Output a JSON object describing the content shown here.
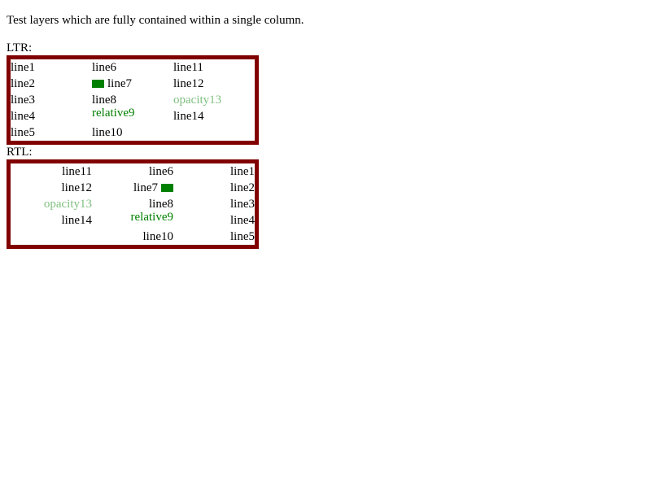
{
  "intro": "Test layers which are fully contained within a single column.",
  "ltr": {
    "label": "LTR:",
    "col1": [
      "line1",
      "line2",
      "line3",
      "line4",
      "line5"
    ],
    "col2": [
      "line6",
      "line7",
      "line8",
      "relative9",
      "line10"
    ],
    "col3": [
      "line11",
      "line12",
      "opacity13",
      "line14"
    ]
  },
  "rtl": {
    "label": "RTL:",
    "col1": [
      "line1",
      "line2",
      "line3",
      "line4",
      "line5"
    ],
    "col2": [
      "line6",
      "line7",
      "line8",
      "relative9",
      "line10"
    ],
    "col3": [
      "line11",
      "line12",
      "opacity13",
      "line14"
    ]
  },
  "colors": {
    "border": "#800000",
    "green": "#008000"
  }
}
